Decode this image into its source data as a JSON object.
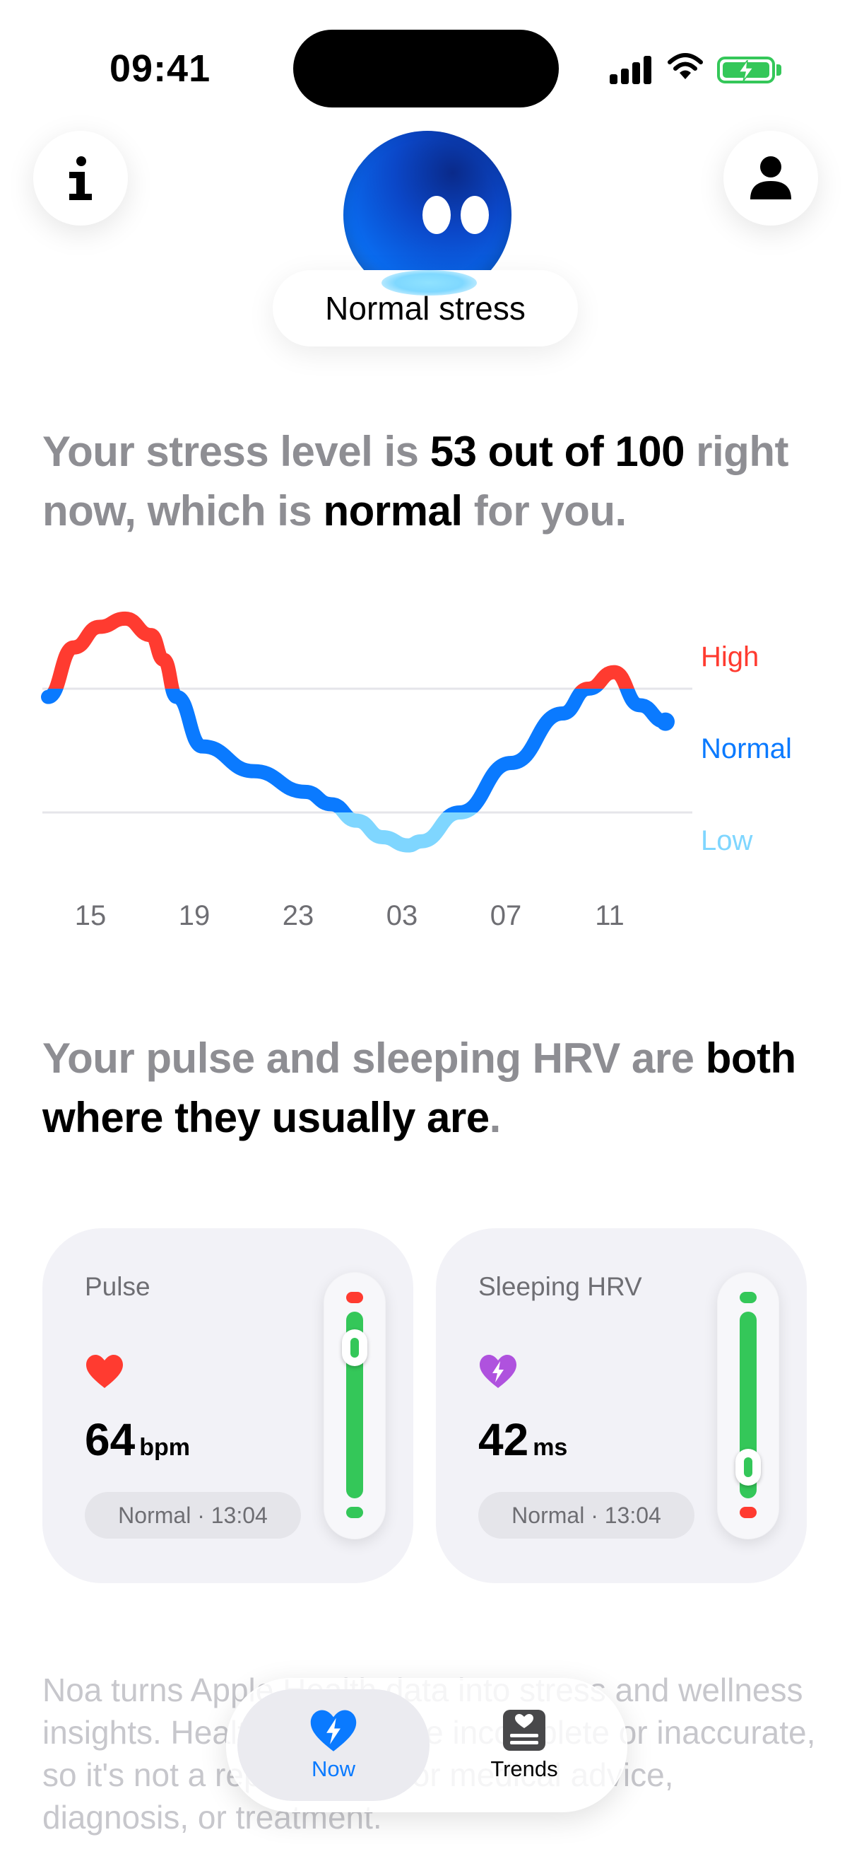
{
  "status_bar": {
    "time": "09:41"
  },
  "mascot": {
    "mood_label": "Normal stress"
  },
  "headline_stress": {
    "part1": "Your stress level is ",
    "bold1": "53 out of 100",
    "part2": " right now, which is ",
    "bold2": "normal",
    "part3": " for you."
  },
  "chart_data": {
    "type": "line",
    "x_ticks": [
      "15",
      "19",
      "23",
      "03",
      "07",
      "11"
    ],
    "band_labels": [
      "High",
      "Normal",
      "Low"
    ],
    "y_range": [
      0,
      100
    ],
    "thresholds": {
      "high": 70,
      "low": 40
    },
    "series": [
      {
        "x": [
          0,
          1,
          2,
          3,
          4,
          4.5,
          5,
          6,
          8,
          10,
          11,
          12,
          13,
          14,
          14.5,
          16,
          18,
          20,
          21,
          22,
          23,
          24
        ],
        "values": [
          68,
          80,
          85,
          87,
          83,
          77,
          68,
          56,
          50,
          45,
          42,
          38,
          34,
          32,
          33,
          40,
          52,
          64,
          70,
          74,
          66,
          62
        ]
      }
    ],
    "current_value": 53,
    "colors": {
      "high": "#ff3b30",
      "normal": "#0a7aff",
      "low": "#7fd6ff"
    }
  },
  "headline_vitals": {
    "part1": "Your pulse and sleeping HRV are ",
    "bold1": "both where they usually are",
    "part2": "."
  },
  "cards": {
    "pulse": {
      "title": "Pulse",
      "value": "64",
      "unit": "bpm",
      "badge": "Normal · 13:04",
      "icon": "heart-icon",
      "gauge_level": 0.82
    },
    "hrv": {
      "title": "Sleeping HRV",
      "value": "42",
      "unit": "ms",
      "badge": "Normal · 13:04",
      "icon": "bolt-heart-icon",
      "gauge_level": 0.25
    }
  },
  "disclaimer": "Noa turns Apple Health data into stress and wellness insights. Health data can be incomplete or inaccurate, so it's not a replacement for medical advice, diagnosis, or treatment.",
  "tabbar": {
    "now_label": "Now",
    "trends_label": "Trends",
    "accent": "#0a7aff"
  }
}
